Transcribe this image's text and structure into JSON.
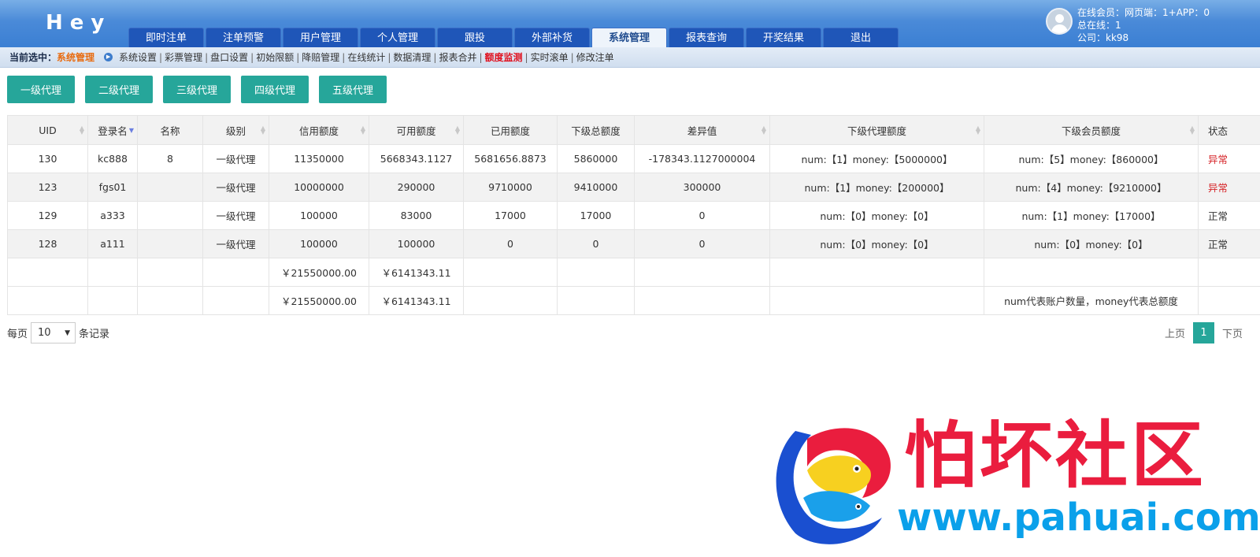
{
  "header": {
    "logo": "Hey",
    "nav_tabs": [
      {
        "label": "即时注单"
      },
      {
        "label": "注单预警"
      },
      {
        "label": "用户管理"
      },
      {
        "label": "个人管理"
      },
      {
        "label": "跟投"
      },
      {
        "label": "外部补货"
      },
      {
        "label": "系统管理",
        "active": true
      },
      {
        "label": "报表查询"
      },
      {
        "label": "开奖结果"
      },
      {
        "label": "退出"
      }
    ],
    "user": {
      "online_line": "在线会员：网页端：1+APP：0",
      "total_line": "总在线：1",
      "company_line": "公司：kk98"
    }
  },
  "breadcrumb": {
    "label": "当前选中：",
    "current": "系统管理",
    "links": [
      "系统设置",
      "彩票管理",
      "盘口设置",
      "初始限额",
      "降赔管理",
      "在线统计",
      "数据清理",
      "报表合并",
      "额度监测",
      "实时滚单",
      "修改注单"
    ],
    "highlight": "额度监测"
  },
  "level_buttons": [
    "一级代理",
    "二级代理",
    "三级代理",
    "四级代理",
    "五级代理"
  ],
  "table": {
    "columns": [
      "UID",
      "登录名",
      "名称",
      "级别",
      "信用额度",
      "可用额度",
      "已用额度",
      "下级总额度",
      "差异值",
      "下级代理额度",
      "下级会员额度",
      "状态"
    ],
    "rows": [
      {
        "uid": "130",
        "login": "kc888",
        "name": "8",
        "level": "一级代理",
        "credit": "11350000",
        "available": "5668343.1127",
        "used": "5681656.8873",
        "sub_total": "5860000",
        "diff": "-178343.1127000004",
        "sub_agent": "num:【1】money:【5000000】",
        "sub_member": "num:【5】money:【860000】",
        "status": "异常"
      },
      {
        "uid": "123",
        "login": "fgs01",
        "name": "",
        "level": "一级代理",
        "credit": "10000000",
        "available": "290000",
        "used": "9710000",
        "sub_total": "9410000",
        "diff": "300000",
        "sub_agent": "num:【1】money:【200000】",
        "sub_member": "num:【4】money:【9210000】",
        "status": "异常"
      },
      {
        "uid": "129",
        "login": "a333",
        "name": "",
        "level": "一级代理",
        "credit": "100000",
        "available": "83000",
        "used": "17000",
        "sub_total": "17000",
        "diff": "0",
        "sub_agent": "num:【0】money:【0】",
        "sub_member": "num:【1】money:【17000】",
        "status": "正常"
      },
      {
        "uid": "128",
        "login": "a111",
        "name": "",
        "level": "一级代理",
        "credit": "100000",
        "available": "100000",
        "used": "0",
        "sub_total": "0",
        "diff": "0",
        "sub_agent": "num:【0】money:【0】",
        "sub_member": "num:【0】money:【0】",
        "status": "正常"
      }
    ],
    "subtotal": {
      "credit": "￥21550000.00",
      "available": "￥6141343.11"
    },
    "total": {
      "credit": "￥21550000.00",
      "available": "￥6141343.11",
      "note": "num代表账户数量，money代表总额度"
    }
  },
  "pager": {
    "per_page_label": "每页",
    "per_page_value": "10",
    "records_label": "条记录",
    "prev": "上页",
    "current": "1",
    "next": "下页"
  },
  "watermark": {
    "title": "怕坏社区",
    "url": "www.pahuai.com"
  },
  "colors": {
    "header_blue": "#3b7fd3",
    "tab_blue": "#1f56b8",
    "teal": "#26a69a",
    "status_bad": "#d6262a",
    "crumb_current": "#e86b10",
    "crumb_highlight": "#e0101e",
    "watermark_red": "#ea1d3e",
    "watermark_blue": "#0aa0ea"
  }
}
